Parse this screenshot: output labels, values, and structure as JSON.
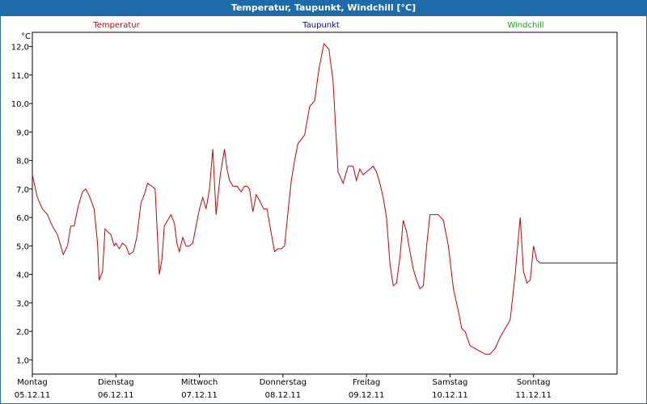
{
  "window": {
    "title": "Temperatur, Taupunkt, Windchill [°C]"
  },
  "chart_data": {
    "type": "line",
    "title": "Temperatur, Taupunkt, Windchill [°C]",
    "ylabel": "°C",
    "ylim": [
      0.5,
      12.5
    ],
    "yticks": [
      1.0,
      2.0,
      3.0,
      4.0,
      5.0,
      6.0,
      7.0,
      8.0,
      9.0,
      10.0,
      11.0,
      12.0
    ],
    "ytick_labels": [
      "1,0",
      "2,0",
      "3,0",
      "4,0",
      "5,0",
      "6,0",
      "7,0",
      "8,0",
      "9,0",
      "10,0",
      "11,0",
      "12,0"
    ],
    "xlim": [
      0,
      7
    ],
    "x_unit": "days since 05.12.11 00:00",
    "xticks": [
      {
        "day": "Montag",
        "date": "05.12.11"
      },
      {
        "day": "Dienstag",
        "date": "06.12.11"
      },
      {
        "day": "Mittwoch",
        "date": "07.12.11"
      },
      {
        "day": "Donnerstag",
        "date": "08.12.11"
      },
      {
        "day": "Freitag",
        "date": "09.12.11"
      },
      {
        "day": "Samstag",
        "date": "10.12.11"
      },
      {
        "day": "Sonntag",
        "date": "11.12.11"
      }
    ],
    "grid": true,
    "legend": [
      {
        "name": "Temperatur",
        "color": "#cc0000",
        "position": "left"
      },
      {
        "name": "Taupunkt",
        "color": "#0000cc",
        "position": "center"
      },
      {
        "name": "Windchill",
        "color": "#00bb00",
        "position": "right"
      }
    ],
    "series": [
      {
        "name": "Temperatur",
        "color": "#cc0000",
        "x": [
          0.0,
          0.06,
          0.12,
          0.18,
          0.24,
          0.3,
          0.33,
          0.37,
          0.42,
          0.46,
          0.5,
          0.55,
          0.6,
          0.64,
          0.69,
          0.74,
          0.78,
          0.8,
          0.84,
          0.87,
          0.9,
          0.94,
          0.98,
          1.0,
          1.04,
          1.08,
          1.12,
          1.16,
          1.21,
          1.25,
          1.3,
          1.34,
          1.38,
          1.43,
          1.47,
          1.52,
          1.55,
          1.58,
          1.62,
          1.66,
          1.7,
          1.73,
          1.76,
          1.8,
          1.84,
          1.88,
          1.92,
          2.0,
          2.04,
          2.08,
          2.12,
          2.16,
          2.2,
          2.25,
          2.3,
          2.33,
          2.36,
          2.4,
          2.45,
          2.5,
          2.54,
          2.57,
          2.6,
          2.64,
          2.68,
          2.72,
          2.77,
          2.81,
          2.85,
          2.9,
          2.94,
          2.98,
          3.02,
          3.06,
          3.1,
          3.14,
          3.18,
          3.21,
          3.26,
          3.32,
          3.38,
          3.43,
          3.49,
          3.55,
          3.6,
          3.66,
          3.72,
          3.78,
          3.84,
          3.88,
          3.92,
          3.96,
          4.0,
          4.04,
          4.08,
          4.12,
          4.16,
          4.2,
          4.24,
          4.28,
          4.32,
          4.36,
          4.4,
          4.44,
          4.48,
          4.52,
          4.56,
          4.6,
          4.64,
          4.68,
          4.72,
          4.76,
          4.8,
          4.86,
          4.92,
          4.98,
          5.04,
          5.1,
          5.14,
          5.18,
          5.24,
          5.3,
          5.36,
          5.42,
          5.48,
          5.54,
          5.6,
          5.66,
          5.72,
          5.78,
          5.84,
          5.88,
          5.92,
          5.96,
          6.0,
          6.04,
          6.08,
          6.12,
          6.16,
          6.2,
          6.26,
          6.32,
          6.38,
          6.44,
          6.5,
          6.56,
          6.62,
          6.68,
          6.74,
          6.8,
          6.84,
          6.88,
          6.92,
          6.96,
          7.0
        ],
        "y": [
          7.5,
          6.7,
          6.3,
          6.1,
          5.7,
          5.4,
          5.1,
          4.7,
          5.0,
          5.7,
          5.7,
          6.4,
          6.9,
          7.0,
          6.7,
          6.3,
          5.1,
          3.8,
          4.1,
          5.6,
          5.5,
          5.4,
          5.0,
          5.1,
          4.9,
          5.1,
          5.0,
          4.7,
          4.8,
          5.3,
          6.5,
          6.8,
          7.2,
          7.1,
          7.0,
          4.0,
          4.5,
          5.7,
          5.9,
          6.1,
          5.8,
          5.1,
          4.8,
          5.3,
          5.0,
          5.0,
          5.1,
          6.3,
          6.7,
          6.3,
          7.0,
          8.4,
          6.1,
          7.5,
          8.4,
          7.7,
          7.3,
          7.1,
          7.1,
          6.9,
          7.1,
          7.1,
          7.0,
          6.2,
          6.8,
          6.6,
          6.3,
          6.3,
          5.6,
          4.8,
          4.9,
          4.9,
          5.0,
          6.2,
          7.3,
          8.0,
          8.6,
          8.7,
          8.9,
          9.9,
          10.1,
          11.2,
          12.1,
          11.9,
          10.8,
          7.6,
          7.2,
          7.8,
          7.8,
          7.3,
          7.7,
          7.5,
          7.6,
          7.7,
          7.8,
          7.6,
          7.2,
          6.7,
          6.0,
          4.4,
          3.6,
          3.7,
          4.6,
          5.9,
          5.5,
          4.8,
          4.2,
          3.8,
          3.5,
          3.6,
          5.0,
          6.1,
          6.1,
          6.1,
          5.9,
          5.0,
          3.5,
          2.7,
          2.1,
          2.0,
          1.5,
          1.4,
          1.3,
          1.2,
          1.2,
          1.4,
          1.8,
          2.1,
          2.4,
          4.0,
          6.0,
          4.1,
          3.7,
          3.8,
          5.0,
          4.5,
          4.4,
          4.4,
          4.4,
          4.4,
          4.4,
          4.4,
          4.4,
          4.4,
          4.4,
          4.4,
          4.4,
          4.4,
          4.4,
          4.4,
          4.4,
          4.4,
          4.4,
          4.4,
          4.4
        ]
      }
    ]
  }
}
